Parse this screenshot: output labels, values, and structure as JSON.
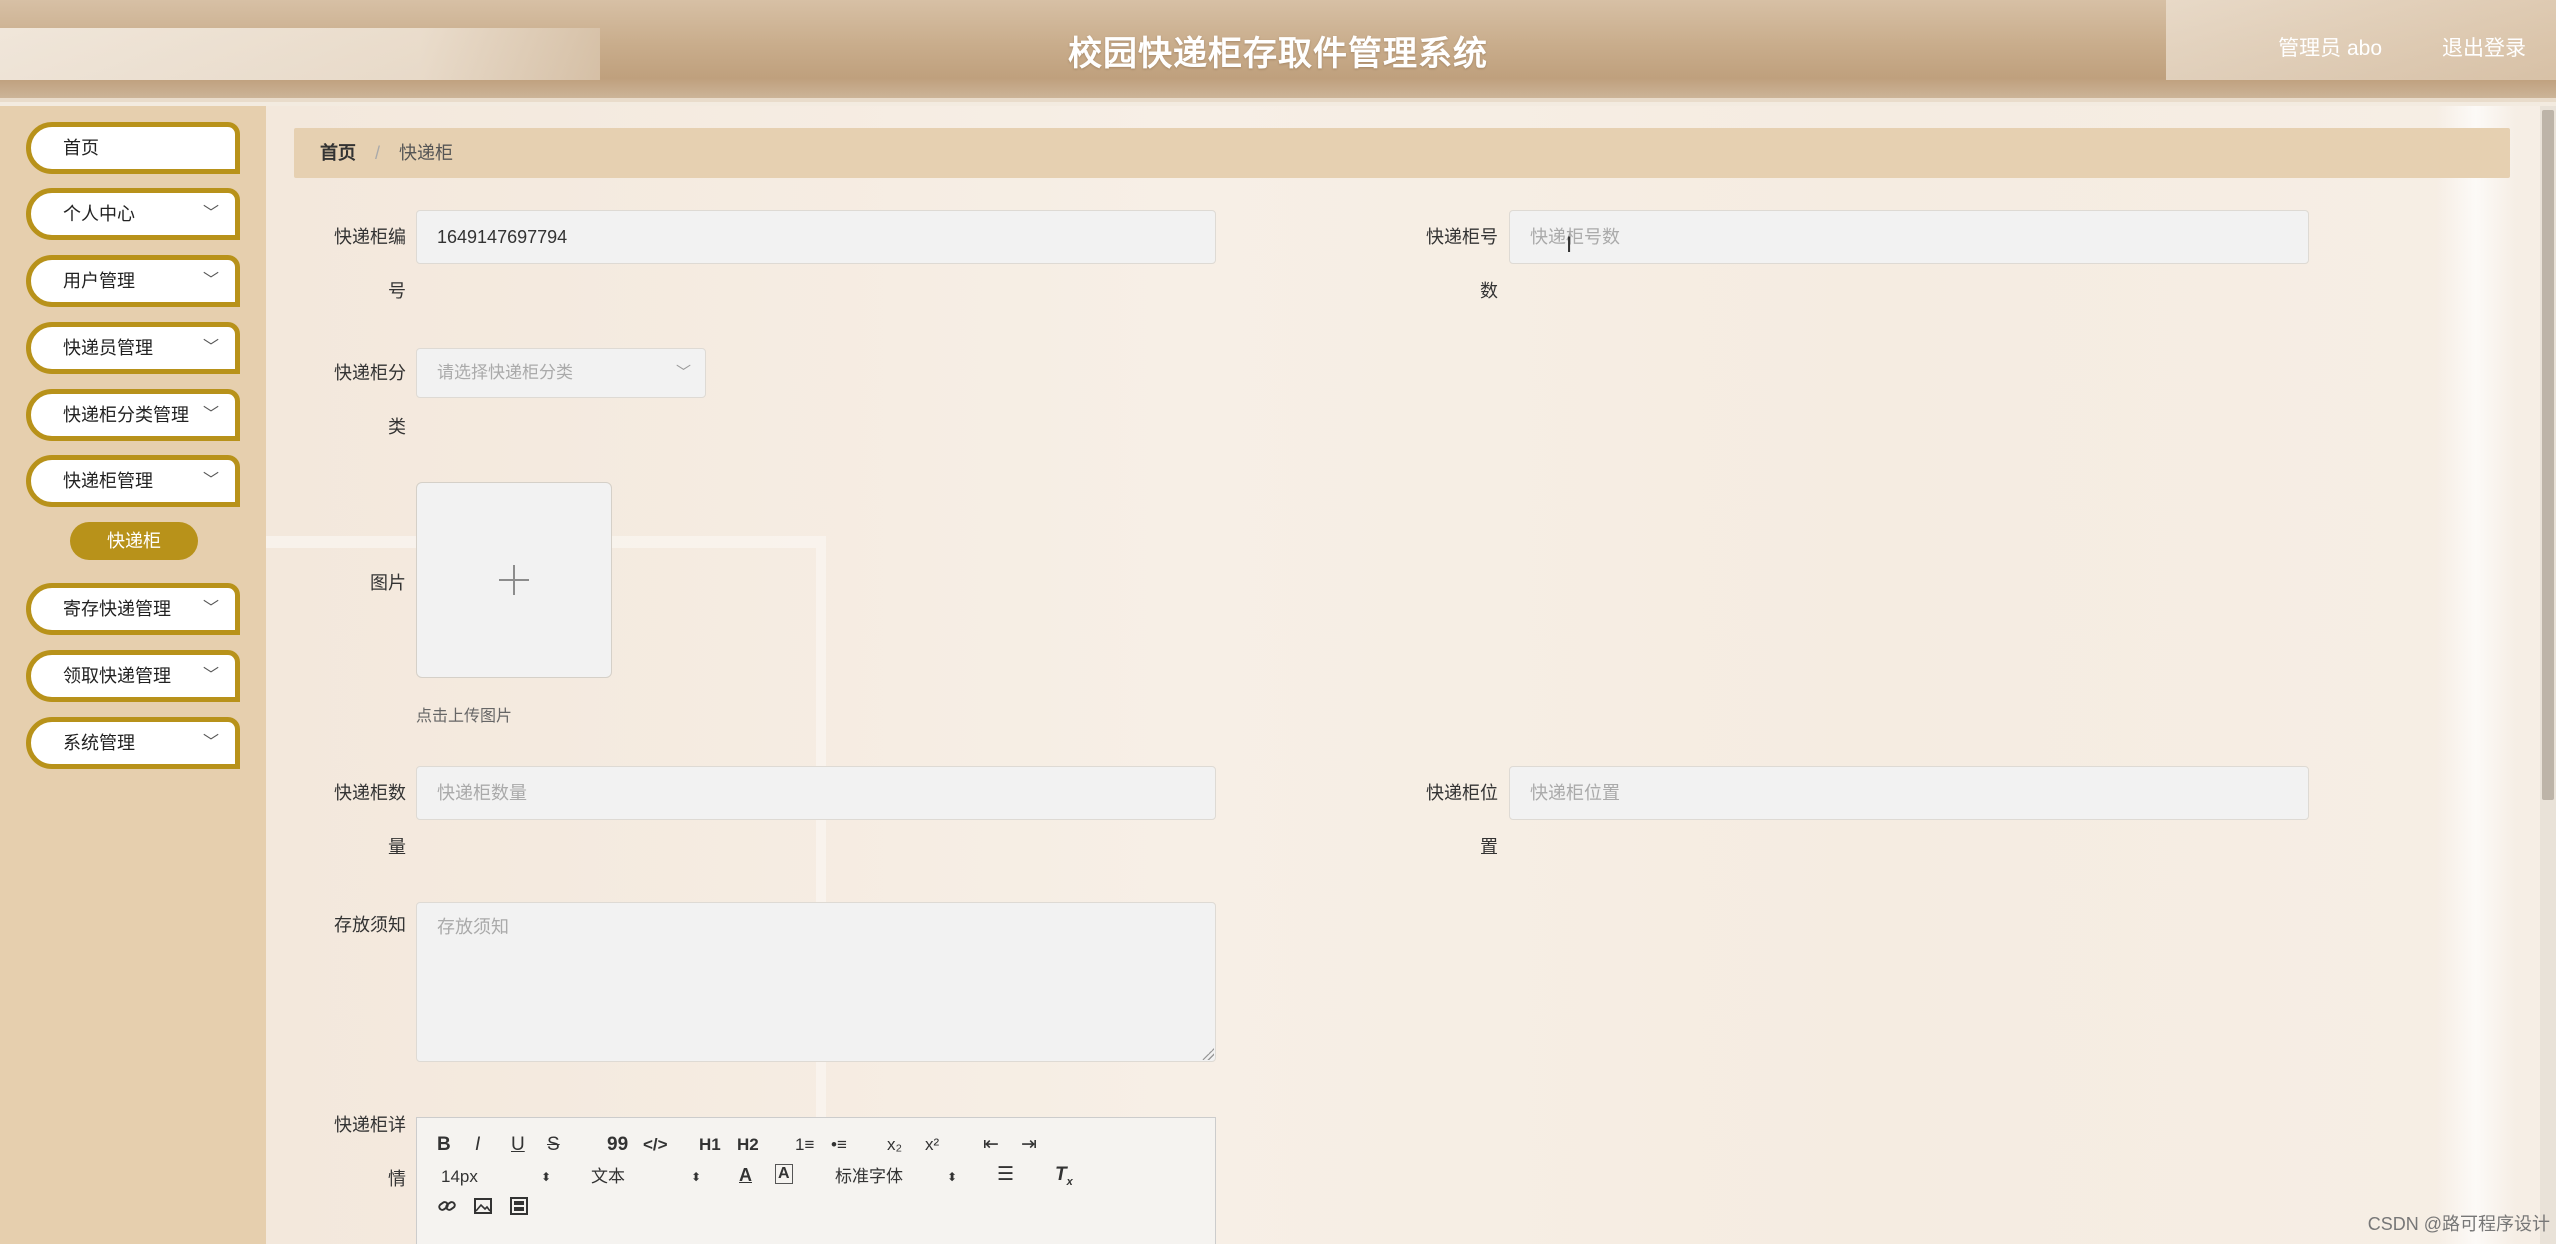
{
  "header": {
    "title": "校园快递柜存取件管理系统",
    "user_label": "管理员 abo",
    "logout_label": "退出登录"
  },
  "sidebar": {
    "items": [
      {
        "label": "首页",
        "has_arrow": false
      },
      {
        "label": "个人中心",
        "has_arrow": true
      },
      {
        "label": "用户管理",
        "has_arrow": true
      },
      {
        "label": "快递员管理",
        "has_arrow": true
      },
      {
        "label": "快递柜分类管理",
        "has_arrow": true
      },
      {
        "label": "快递柜管理",
        "has_arrow": true
      },
      {
        "label": "寄存快递管理",
        "has_arrow": true
      },
      {
        "label": "领取快递管理",
        "has_arrow": true
      },
      {
        "label": "系统管理",
        "has_arrow": true
      }
    ],
    "active_submenu": "快递柜"
  },
  "breadcrumb": {
    "home": "首页",
    "separator": "/",
    "current": "快递柜"
  },
  "form": {
    "code_label_line1": "快递柜编",
    "code_label_line2": "号",
    "code_value": "1649147697794",
    "number_label_line1": "快递柜号",
    "number_label_line2": "数",
    "number_placeholder": "快递柜号数",
    "category_label_line1": "快递柜分",
    "category_label_line2": "类",
    "category_placeholder": "请选择快递柜分类",
    "image_label": "图片",
    "upload_tip": "点击上传图片",
    "quantity_label_line1": "快递柜数",
    "quantity_label_line2": "量",
    "quantity_placeholder": "快递柜数量",
    "location_label_line1": "快递柜位",
    "location_label_line2": "置",
    "location_placeholder": "快递柜位置",
    "notice_label": "存放须知",
    "notice_placeholder": "存放须知",
    "detail_label_line1": "快递柜详",
    "detail_label_line2": "情"
  },
  "editor_toolbar": {
    "bold": "B",
    "italic": "I",
    "underline": "U",
    "strike": "S",
    "blockquote": "99",
    "code": "</>",
    "h1": "H1",
    "h2": "H2",
    "ordered_list": "1≡",
    "bullet_list": "•≡",
    "subscript": "x₂",
    "superscript": "x²",
    "indent_left": "⇤",
    "indent_right": "⇥",
    "font_size": "14px",
    "header_select": "文本",
    "font_family": "标准字体"
  },
  "watermark": "CSDN @路可程序设计"
}
